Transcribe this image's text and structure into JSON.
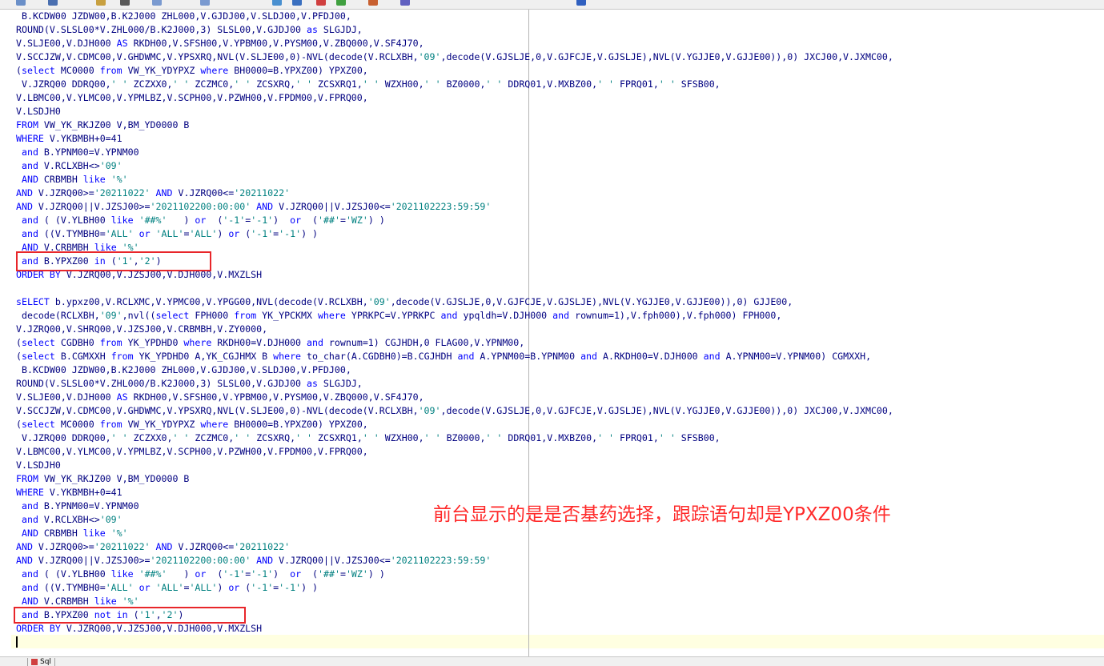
{
  "theme": {
    "keyword_color": "#0000ff",
    "string_color": "#008080",
    "text_color": "#000080",
    "highlight_box_color": "#e8262a",
    "annotation_color": "#ff2a2a",
    "current_line_color": "#ffffe1"
  },
  "toolbar": {
    "icons": [
      "save-icon",
      "copy-icon",
      "paste-icon",
      "print-icon",
      "undo-icon",
      "redo-icon",
      "find-icon",
      "execute-icon",
      "stop-icon",
      "commit-icon",
      "rollback-icon",
      "explain-icon",
      "help-icon"
    ]
  },
  "annotation": "前台显示的是是否基药选择，跟踪语句却是YPXZ00条件",
  "statusbar": {
    "tab_label": "Sql"
  },
  "editor": {
    "lines": [
      [
        [
          "t",
          " B.KCDW00 JZDW00,B.K2J000 ZHL000,V.GJDJ00,V.SLDJ00,V.PFDJ00,"
        ]
      ],
      [
        [
          "t",
          "ROUND(V.SLSL00*V.ZHL000/B.K2J000,3) SLSL00,V.GJDJ00 "
        ],
        [
          "k",
          "as"
        ],
        [
          "t",
          " SLGJDJ,"
        ]
      ],
      [
        [
          "t",
          "V.SLJE00,V.DJH000 "
        ],
        [
          "k",
          "AS"
        ],
        [
          "t",
          " RKDH00,V.SFSH00,V.YPBM00,V.PYSM00,V.ZBQ000,V.SF4J70,"
        ]
      ],
      [
        [
          "t",
          "V.SCCJZW,V.CDMC00,V.GHDWMC,V.YPSXRQ,NVL(V.SLJE00,0)-NVL(decode(V.RCLXBH,"
        ],
        [
          "s",
          "'09'"
        ],
        [
          "t",
          ",decode(V.GJSLJE,0,V.GJFCJE,V.GJSLJE),NVL(V.YGJJE0,V.GJJE00)),0) JXCJ00,V.JXMC00,"
        ]
      ],
      [
        [
          "t",
          "("
        ],
        [
          "k",
          "select"
        ],
        [
          "t",
          " MC0000 "
        ],
        [
          "k",
          "from"
        ],
        [
          "t",
          " VW_YK_YDYPXZ "
        ],
        [
          "k",
          "where"
        ],
        [
          "t",
          " BH0000=B.YPXZ00) YPXZ00,"
        ]
      ],
      [
        [
          "t",
          " V.JZRQ00 DDRQ00,"
        ],
        [
          "s",
          "' '"
        ],
        [
          "t",
          " ZCZXX0,"
        ],
        [
          "s",
          "' '"
        ],
        [
          "t",
          " ZCZMC0,"
        ],
        [
          "s",
          "' '"
        ],
        [
          "t",
          " ZCSXRQ,"
        ],
        [
          "s",
          "' '"
        ],
        [
          "t",
          " ZCSXRQ1,"
        ],
        [
          "s",
          "' '"
        ],
        [
          "t",
          " WZXH00,"
        ],
        [
          "s",
          "' '"
        ],
        [
          "t",
          " BZ0000,"
        ],
        [
          "s",
          "' '"
        ],
        [
          "t",
          " DDRQ01,V.MXBZ00,"
        ],
        [
          "s",
          "' '"
        ],
        [
          "t",
          " FPRQ01,"
        ],
        [
          "s",
          "' '"
        ],
        [
          "t",
          " SFSB00,"
        ]
      ],
      [
        [
          "t",
          "V.LBMC00,V.YLMC00,V.YPMLBZ,V.SCPH00,V.PZWH00,V.FPDM00,V.FPRQ00,"
        ]
      ],
      [
        [
          "t",
          "V.LSDJH0"
        ]
      ],
      [
        [
          "k",
          "FROM"
        ],
        [
          "t",
          " VW_YK_RKJZ00 V,BM_YD0000 B"
        ]
      ],
      [
        [
          "k",
          "WHERE"
        ],
        [
          "t",
          " V.YKBMBH+0=41"
        ]
      ],
      [
        [
          "t",
          " "
        ],
        [
          "k",
          "and"
        ],
        [
          "t",
          " B.YPNM00=V.YPNM00"
        ]
      ],
      [
        [
          "t",
          " "
        ],
        [
          "k",
          "and"
        ],
        [
          "t",
          " V.RCLXBH<>"
        ],
        [
          "s",
          "'09'"
        ]
      ],
      [
        [
          "t",
          " "
        ],
        [
          "k",
          "AND"
        ],
        [
          "t",
          " CRBMBH "
        ],
        [
          "k",
          "like"
        ],
        [
          "t",
          " "
        ],
        [
          "s",
          "'%'"
        ]
      ],
      [
        [
          "k",
          "AND"
        ],
        [
          "t",
          " V.JZRQ00>="
        ],
        [
          "s",
          "'20211022'"
        ],
        [
          "t",
          " "
        ],
        [
          "k",
          "AND"
        ],
        [
          "t",
          " V.JZRQ00<="
        ],
        [
          "s",
          "'20211022'"
        ]
      ],
      [
        [
          "k",
          "AND"
        ],
        [
          "t",
          " V.JZRQ00||V.JZSJ00>="
        ],
        [
          "s",
          "'2021102200:00:00'"
        ],
        [
          "t",
          " "
        ],
        [
          "k",
          "AND"
        ],
        [
          "t",
          " V.JZRQ00||V.JZSJ00<="
        ],
        [
          "s",
          "'2021102223:59:59'"
        ]
      ],
      [
        [
          "t",
          " "
        ],
        [
          "k",
          "and"
        ],
        [
          "t",
          " ( (V.YLBH00 "
        ],
        [
          "k",
          "like"
        ],
        [
          "t",
          " "
        ],
        [
          "s",
          "'##%'"
        ],
        [
          "t",
          "   ) "
        ],
        [
          "k",
          "or"
        ],
        [
          "t",
          "  ("
        ],
        [
          "s",
          "'-1'"
        ],
        [
          "t",
          "="
        ],
        [
          "s",
          "'-1'"
        ],
        [
          "t",
          ")  "
        ],
        [
          "k",
          "or"
        ],
        [
          "t",
          "  ("
        ],
        [
          "s",
          "'##'"
        ],
        [
          "t",
          "="
        ],
        [
          "s",
          "'WZ'"
        ],
        [
          "t",
          ") )"
        ]
      ],
      [
        [
          "t",
          " "
        ],
        [
          "k",
          "and"
        ],
        [
          "t",
          " ((V.TYMBH0="
        ],
        [
          "s",
          "'ALL'"
        ],
        [
          "t",
          " "
        ],
        [
          "k",
          "or"
        ],
        [
          "t",
          " "
        ],
        [
          "s",
          "'ALL'"
        ],
        [
          "t",
          "="
        ],
        [
          "s",
          "'ALL'"
        ],
        [
          "t",
          ") "
        ],
        [
          "k",
          "or"
        ],
        [
          "t",
          " ("
        ],
        [
          "s",
          "'-1'"
        ],
        [
          "t",
          "="
        ],
        [
          "s",
          "'-1'"
        ],
        [
          "t",
          ") )"
        ]
      ],
      [
        [
          "t",
          " "
        ],
        [
          "k",
          "AND"
        ],
        [
          "t",
          " V.CRBMBH "
        ],
        [
          "k",
          "like"
        ],
        [
          "t",
          " "
        ],
        [
          "s",
          "'%'"
        ]
      ],
      [
        [
          "t",
          " "
        ],
        [
          "k",
          "and"
        ],
        [
          "t",
          " B.YPXZ00 "
        ],
        [
          "k",
          "in"
        ],
        [
          "t",
          " ("
        ],
        [
          "s",
          "'1'"
        ],
        [
          "t",
          ","
        ],
        [
          "s",
          "'2'"
        ],
        [
          "t",
          ")"
        ]
      ],
      [
        [
          "k",
          "ORDER BY"
        ],
        [
          "t",
          " V.JZRQ00,V.JZSJ00,V.DJH000,V.MXZLSH"
        ]
      ],
      [
        [
          "t",
          ""
        ]
      ],
      [
        [
          "k",
          "sELECT"
        ],
        [
          "t",
          " b.ypxz00,V.RCLXMC,V.YPMC00,V.YPGG00,NVL(decode(V.RCLXBH,"
        ],
        [
          "s",
          "'09'"
        ],
        [
          "t",
          ",decode(V.GJSLJE,0,V.GJFCJE,V.GJSLJE),NVL(V.YGJJE0,V.GJJE00)),0) GJJE00,"
        ]
      ],
      [
        [
          "t",
          " decode(RCLXBH,"
        ],
        [
          "s",
          "'09'"
        ],
        [
          "t",
          ",nvl(("
        ],
        [
          "k",
          "select"
        ],
        [
          "t",
          " FPH000 "
        ],
        [
          "k",
          "from"
        ],
        [
          "t",
          " YK_YPCKMX "
        ],
        [
          "k",
          "where"
        ],
        [
          "t",
          " YPRKPC=V.YPRKPC "
        ],
        [
          "k",
          "and"
        ],
        [
          "t",
          " ypqldh=V.DJH000 "
        ],
        [
          "k",
          "and"
        ],
        [
          "t",
          " rownum=1),V.fph000),V.fph000) FPH000,"
        ]
      ],
      [
        [
          "t",
          "V.JZRQ00,V.SHRQ00,V.JZSJ00,V.CRBMBH,V.ZY0000,"
        ]
      ],
      [
        [
          "t",
          "("
        ],
        [
          "k",
          "select"
        ],
        [
          "t",
          " CGDBH0 "
        ],
        [
          "k",
          "from"
        ],
        [
          "t",
          " YK_YPDHD0 "
        ],
        [
          "k",
          "where"
        ],
        [
          "t",
          " RKDH00=V.DJH000 "
        ],
        [
          "k",
          "and"
        ],
        [
          "t",
          " rownum=1) CGJHDH,0 FLAG00,V.YPNM00,"
        ]
      ],
      [
        [
          "t",
          "("
        ],
        [
          "k",
          "select"
        ],
        [
          "t",
          " B.CGMXXH "
        ],
        [
          "k",
          "from"
        ],
        [
          "t",
          " YK_YPDHD0 A,YK_CGJHMX B "
        ],
        [
          "k",
          "where"
        ],
        [
          "t",
          " to_char(A.CGDBH0)=B.CGJHDH "
        ],
        [
          "k",
          "and"
        ],
        [
          "t",
          " A.YPNM00=B.YPNM00 "
        ],
        [
          "k",
          "and"
        ],
        [
          "t",
          " A.RKDH00=V.DJH000 "
        ],
        [
          "k",
          "and"
        ],
        [
          "t",
          " A.YPNM00=V.YPNM00) CGMXXH,"
        ]
      ],
      [
        [
          "t",
          " B.KCDW00 JZDW00,B.K2J000 ZHL000,V.GJDJ00,V.SLDJ00,V.PFDJ00,"
        ]
      ],
      [
        [
          "t",
          "ROUND(V.SLSL00*V.ZHL000/B.K2J000,3) SLSL00,V.GJDJ00 "
        ],
        [
          "k",
          "as"
        ],
        [
          "t",
          " SLGJDJ,"
        ]
      ],
      [
        [
          "t",
          "V.SLJE00,V.DJH000 "
        ],
        [
          "k",
          "AS"
        ],
        [
          "t",
          " RKDH00,V.SFSH00,V.YPBM00,V.PYSM00,V.ZBQ000,V.SF4J70,"
        ]
      ],
      [
        [
          "t",
          "V.SCCJZW,V.CDMC00,V.GHDWMC,V.YPSXRQ,NVL(V.SLJE00,0)-NVL(decode(V.RCLXBH,"
        ],
        [
          "s",
          "'09'"
        ],
        [
          "t",
          ",decode(V.GJSLJE,0,V.GJFCJE,V.GJSLJE),NVL(V.YGJJE0,V.GJJE00)),0) JXCJ00,V.JXMC00,"
        ]
      ],
      [
        [
          "t",
          "("
        ],
        [
          "k",
          "select"
        ],
        [
          "t",
          " MC0000 "
        ],
        [
          "k",
          "from"
        ],
        [
          "t",
          " VW_YK_YDYPXZ "
        ],
        [
          "k",
          "where"
        ],
        [
          "t",
          " BH0000=B.YPXZ00) YPXZ00,"
        ]
      ],
      [
        [
          "t",
          " V.JZRQ00 DDRQ00,"
        ],
        [
          "s",
          "' '"
        ],
        [
          "t",
          " ZCZXX0,"
        ],
        [
          "s",
          "' '"
        ],
        [
          "t",
          " ZCZMC0,"
        ],
        [
          "s",
          "' '"
        ],
        [
          "t",
          " ZCSXRQ,"
        ],
        [
          "s",
          "' '"
        ],
        [
          "t",
          " ZCSXRQ1,"
        ],
        [
          "s",
          "' '"
        ],
        [
          "t",
          " WZXH00,"
        ],
        [
          "s",
          "' '"
        ],
        [
          "t",
          " BZ0000,"
        ],
        [
          "s",
          "' '"
        ],
        [
          "t",
          " DDRQ01,V.MXBZ00,"
        ],
        [
          "s",
          "' '"
        ],
        [
          "t",
          " FPRQ01,"
        ],
        [
          "s",
          "' '"
        ],
        [
          "t",
          " SFSB00,"
        ]
      ],
      [
        [
          "t",
          "V.LBMC00,V.YLMC00,V.YPMLBZ,V.SCPH00,V.PZWH00,V.FPDM00,V.FPRQ00,"
        ]
      ],
      [
        [
          "t",
          "V.LSDJH0"
        ]
      ],
      [
        [
          "k",
          "FROM"
        ],
        [
          "t",
          " VW_YK_RKJZ00 V,BM_YD0000 B"
        ]
      ],
      [
        [
          "k",
          "WHERE"
        ],
        [
          "t",
          " V.YKBMBH+0=41"
        ]
      ],
      [
        [
          "t",
          " "
        ],
        [
          "k",
          "and"
        ],
        [
          "t",
          " B.YPNM00=V.YPNM00"
        ]
      ],
      [
        [
          "t",
          " "
        ],
        [
          "k",
          "and"
        ],
        [
          "t",
          " V.RCLXBH<>"
        ],
        [
          "s",
          "'09'"
        ]
      ],
      [
        [
          "t",
          " "
        ],
        [
          "k",
          "AND"
        ],
        [
          "t",
          " CRBMBH "
        ],
        [
          "k",
          "like"
        ],
        [
          "t",
          " "
        ],
        [
          "s",
          "'%'"
        ]
      ],
      [
        [
          "k",
          "AND"
        ],
        [
          "t",
          " V.JZRQ00>="
        ],
        [
          "s",
          "'20211022'"
        ],
        [
          "t",
          " "
        ],
        [
          "k",
          "AND"
        ],
        [
          "t",
          " V.JZRQ00<="
        ],
        [
          "s",
          "'20211022'"
        ]
      ],
      [
        [
          "k",
          "AND"
        ],
        [
          "t",
          " V.JZRQ00||V.JZSJ00>="
        ],
        [
          "s",
          "'2021102200:00:00'"
        ],
        [
          "t",
          " "
        ],
        [
          "k",
          "AND"
        ],
        [
          "t",
          " V.JZRQ00||V.JZSJ00<="
        ],
        [
          "s",
          "'2021102223:59:59'"
        ]
      ],
      [
        [
          "t",
          " "
        ],
        [
          "k",
          "and"
        ],
        [
          "t",
          " ( (V.YLBH00 "
        ],
        [
          "k",
          "like"
        ],
        [
          "t",
          " "
        ],
        [
          "s",
          "'##%'"
        ],
        [
          "t",
          "   ) "
        ],
        [
          "k",
          "or"
        ],
        [
          "t",
          "  ("
        ],
        [
          "s",
          "'-1'"
        ],
        [
          "t",
          "="
        ],
        [
          "s",
          "'-1'"
        ],
        [
          "t",
          ")  "
        ],
        [
          "k",
          "or"
        ],
        [
          "t",
          "  ("
        ],
        [
          "s",
          "'##'"
        ],
        [
          "t",
          "="
        ],
        [
          "s",
          "'WZ'"
        ],
        [
          "t",
          ") )"
        ]
      ],
      [
        [
          "t",
          " "
        ],
        [
          "k",
          "and"
        ],
        [
          "t",
          " ((V.TYMBH0="
        ],
        [
          "s",
          "'ALL'"
        ],
        [
          "t",
          " "
        ],
        [
          "k",
          "or"
        ],
        [
          "t",
          " "
        ],
        [
          "s",
          "'ALL'"
        ],
        [
          "t",
          "="
        ],
        [
          "s",
          "'ALL'"
        ],
        [
          "t",
          ") "
        ],
        [
          "k",
          "or"
        ],
        [
          "t",
          " ("
        ],
        [
          "s",
          "'-1'"
        ],
        [
          "t",
          "="
        ],
        [
          "s",
          "'-1'"
        ],
        [
          "t",
          ") )"
        ]
      ],
      [
        [
          "t",
          " "
        ],
        [
          "k",
          "AND"
        ],
        [
          "t",
          " V.CRBMBH "
        ],
        [
          "k",
          "like"
        ],
        [
          "t",
          " "
        ],
        [
          "s",
          "'%'"
        ]
      ],
      [
        [
          "t",
          " "
        ],
        [
          "k",
          "and"
        ],
        [
          "t",
          " B.YPXZ00 "
        ],
        [
          "k",
          "not in"
        ],
        [
          "t",
          " ("
        ],
        [
          "s",
          "'1'"
        ],
        [
          "t",
          ","
        ],
        [
          "s",
          "'2'"
        ],
        [
          "t",
          ")"
        ]
      ],
      [
        [
          "k",
          "ORDER BY"
        ],
        [
          "t",
          " V.JZRQ00,V.JZSJ00,V.DJH000,V.MXZLSH"
        ]
      ]
    ]
  }
}
